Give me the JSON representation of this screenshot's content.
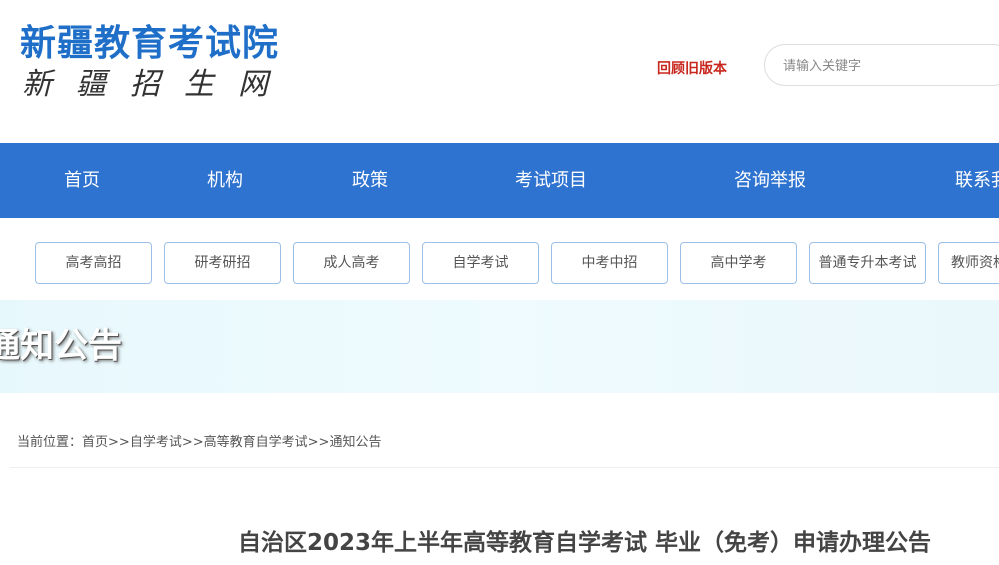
{
  "header": {
    "site_name": "新疆教育考试院",
    "site_subtitle": "新疆招生网",
    "old_version_link": "回顾旧版本",
    "search": {
      "placeholder": "请输入关键字",
      "value": ""
    }
  },
  "nav": {
    "items": [
      {
        "label": "首页"
      },
      {
        "label": "机构"
      },
      {
        "label": "政策"
      },
      {
        "label": "考试项目"
      },
      {
        "label": "咨询举报"
      },
      {
        "label": "联系我们"
      }
    ]
  },
  "categories": [
    {
      "label": "高考高招"
    },
    {
      "label": "研考研招"
    },
    {
      "label": "成人高考"
    },
    {
      "label": "自学考试"
    },
    {
      "label": "中考中招"
    },
    {
      "label": "高中学考"
    },
    {
      "label": "普通专升本考试"
    },
    {
      "label": "教师资格"
    }
  ],
  "banner": {
    "title": "通知公告"
  },
  "breadcrumb": {
    "prefix": "当前位置：",
    "items": [
      {
        "label": "首页"
      },
      {
        "label": "自学考试"
      },
      {
        "label": "高等教育自学考试"
      },
      {
        "label": "通知公告"
      }
    ],
    "separator": ">>"
  },
  "article": {
    "title": "自治区2023年上半年高等教育自学考试 毕业（免考）申请办理公告"
  },
  "colors": {
    "brand_blue": "#1f6fc9",
    "nav_blue": "#2f73d0",
    "link_red": "#c8281e",
    "banner_bg": "#e7f8fc"
  }
}
